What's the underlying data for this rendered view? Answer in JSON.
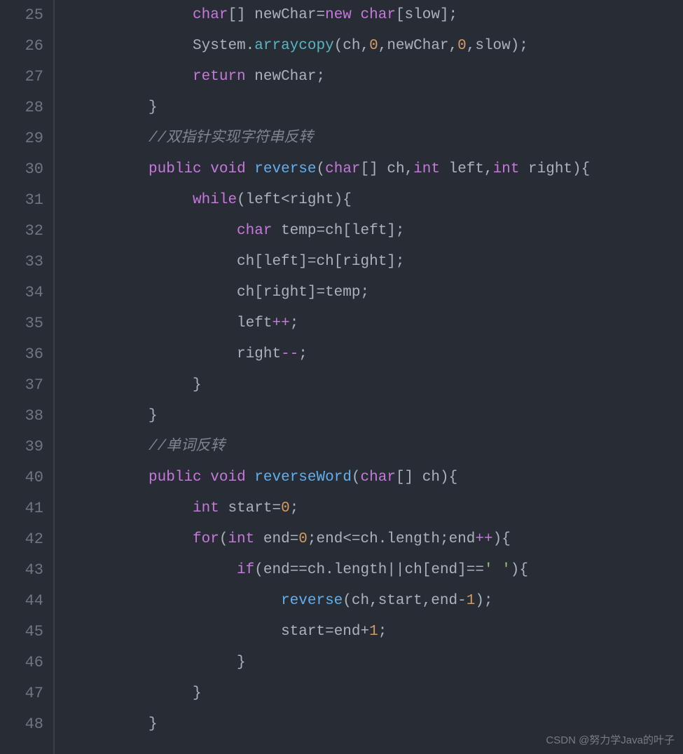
{
  "watermark": "CSDN @努力学Java的叶子",
  "lines": [
    {
      "num": 25,
      "indent": 3,
      "tokens": [
        {
          "t": "char",
          "c": "keyword"
        },
        {
          "t": "[] newChar",
          "c": "default"
        },
        {
          "t": "=",
          "c": "op"
        },
        {
          "t": "new",
          "c": "keyword"
        },
        {
          "t": " ",
          "c": "default"
        },
        {
          "t": "char",
          "c": "keyword"
        },
        {
          "t": "[slow];",
          "c": "default"
        }
      ]
    },
    {
      "num": 26,
      "indent": 3,
      "tokens": [
        {
          "t": "System",
          "c": "default"
        },
        {
          "t": ".",
          "c": "punct"
        },
        {
          "t": "arraycopy",
          "c": "method"
        },
        {
          "t": "(ch,",
          "c": "default"
        },
        {
          "t": "0",
          "c": "num"
        },
        {
          "t": ",newChar,",
          "c": "default"
        },
        {
          "t": "0",
          "c": "num"
        },
        {
          "t": ",slow);",
          "c": "default"
        }
      ]
    },
    {
      "num": 27,
      "indent": 3,
      "tokens": [
        {
          "t": "return",
          "c": "keyword"
        },
        {
          "t": " newChar;",
          "c": "default"
        }
      ]
    },
    {
      "num": 28,
      "indent": 2,
      "tokens": [
        {
          "t": "}",
          "c": "punct"
        }
      ]
    },
    {
      "num": 29,
      "indent": 2,
      "tokens": [
        {
          "t": "//双指针实现字符串反转",
          "c": "comment"
        }
      ]
    },
    {
      "num": 30,
      "indent": 2,
      "tokens": [
        {
          "t": "public",
          "c": "keyword"
        },
        {
          "t": " ",
          "c": "default"
        },
        {
          "t": "void",
          "c": "keyword"
        },
        {
          "t": " ",
          "c": "default"
        },
        {
          "t": "reverse",
          "c": "call"
        },
        {
          "t": "(",
          "c": "punct"
        },
        {
          "t": "char",
          "c": "keyword"
        },
        {
          "t": "[] ch,",
          "c": "default"
        },
        {
          "t": "int",
          "c": "keyword"
        },
        {
          "t": " left,",
          "c": "default"
        },
        {
          "t": "int",
          "c": "keyword"
        },
        {
          "t": " right){",
          "c": "default"
        }
      ]
    },
    {
      "num": 31,
      "indent": 3,
      "tokens": [
        {
          "t": "while",
          "c": "keyword"
        },
        {
          "t": "(left",
          "c": "default"
        },
        {
          "t": "<",
          "c": "op"
        },
        {
          "t": "right){",
          "c": "default"
        }
      ]
    },
    {
      "num": 32,
      "indent": 4,
      "tokens": [
        {
          "t": "char",
          "c": "keyword"
        },
        {
          "t": " temp",
          "c": "default"
        },
        {
          "t": "=",
          "c": "op"
        },
        {
          "t": "ch[left];",
          "c": "default"
        }
      ]
    },
    {
      "num": 33,
      "indent": 4,
      "tokens": [
        {
          "t": "ch[left]",
          "c": "default"
        },
        {
          "t": "=",
          "c": "op"
        },
        {
          "t": "ch[right];",
          "c": "default"
        }
      ]
    },
    {
      "num": 34,
      "indent": 4,
      "tokens": [
        {
          "t": "ch[right]",
          "c": "default"
        },
        {
          "t": "=",
          "c": "op"
        },
        {
          "t": "temp;",
          "c": "default"
        }
      ]
    },
    {
      "num": 35,
      "indent": 4,
      "tokens": [
        {
          "t": "left",
          "c": "default"
        },
        {
          "t": "++",
          "c": "keyword"
        },
        {
          "t": ";",
          "c": "punct"
        }
      ]
    },
    {
      "num": 36,
      "indent": 4,
      "tokens": [
        {
          "t": "right",
          "c": "default"
        },
        {
          "t": "--",
          "c": "keyword"
        },
        {
          "t": ";",
          "c": "punct"
        }
      ]
    },
    {
      "num": 37,
      "indent": 3,
      "tokens": [
        {
          "t": "}",
          "c": "punct"
        }
      ]
    },
    {
      "num": 38,
      "indent": 2,
      "tokens": [
        {
          "t": "}",
          "c": "punct"
        }
      ]
    },
    {
      "num": 39,
      "indent": 2,
      "tokens": [
        {
          "t": "//单词反转",
          "c": "comment"
        }
      ]
    },
    {
      "num": 40,
      "indent": 2,
      "tokens": [
        {
          "t": "public",
          "c": "keyword"
        },
        {
          "t": " ",
          "c": "default"
        },
        {
          "t": "void",
          "c": "keyword"
        },
        {
          "t": " ",
          "c": "default"
        },
        {
          "t": "reverseWord",
          "c": "call"
        },
        {
          "t": "(",
          "c": "punct"
        },
        {
          "t": "char",
          "c": "keyword"
        },
        {
          "t": "[] ch){",
          "c": "default"
        }
      ]
    },
    {
      "num": 41,
      "indent": 3,
      "tokens": [
        {
          "t": "int",
          "c": "keyword"
        },
        {
          "t": " start",
          "c": "default"
        },
        {
          "t": "=",
          "c": "op"
        },
        {
          "t": "0",
          "c": "num"
        },
        {
          "t": ";",
          "c": "punct"
        }
      ]
    },
    {
      "num": 42,
      "indent": 3,
      "tokens": [
        {
          "t": "for",
          "c": "keyword"
        },
        {
          "t": "(",
          "c": "punct"
        },
        {
          "t": "int",
          "c": "keyword"
        },
        {
          "t": " end",
          "c": "default"
        },
        {
          "t": "=",
          "c": "op"
        },
        {
          "t": "0",
          "c": "num"
        },
        {
          "t": ";end",
          "c": "default"
        },
        {
          "t": "<=",
          "c": "op"
        },
        {
          "t": "ch.length;end",
          "c": "default"
        },
        {
          "t": "++",
          "c": "keyword"
        },
        {
          "t": "){",
          "c": "default"
        }
      ]
    },
    {
      "num": 43,
      "indent": 4,
      "tokens": [
        {
          "t": "if",
          "c": "keyword"
        },
        {
          "t": "(end",
          "c": "default"
        },
        {
          "t": "==",
          "c": "op"
        },
        {
          "t": "ch.length",
          "c": "default"
        },
        {
          "t": "||",
          "c": "op"
        },
        {
          "t": "ch[end]",
          "c": "default"
        },
        {
          "t": "==",
          "c": "op"
        },
        {
          "t": "' '",
          "c": "str"
        },
        {
          "t": "){",
          "c": "default"
        }
      ]
    },
    {
      "num": 44,
      "indent": 5,
      "tokens": [
        {
          "t": "reverse",
          "c": "call"
        },
        {
          "t": "(ch,start,end",
          "c": "default"
        },
        {
          "t": "-",
          "c": "op"
        },
        {
          "t": "1",
          "c": "num"
        },
        {
          "t": ");",
          "c": "default"
        }
      ]
    },
    {
      "num": 45,
      "indent": 5,
      "tokens": [
        {
          "t": "start",
          "c": "default"
        },
        {
          "t": "=",
          "c": "op"
        },
        {
          "t": "end",
          "c": "default"
        },
        {
          "t": "+",
          "c": "op"
        },
        {
          "t": "1",
          "c": "num"
        },
        {
          "t": ";",
          "c": "punct"
        }
      ]
    },
    {
      "num": 46,
      "indent": 4,
      "tokens": [
        {
          "t": "}",
          "c": "punct"
        }
      ]
    },
    {
      "num": 47,
      "indent": 3,
      "tokens": [
        {
          "t": "}",
          "c": "punct"
        }
      ]
    },
    {
      "num": 48,
      "indent": 2,
      "tokens": [
        {
          "t": "}",
          "c": "punct"
        }
      ]
    }
  ]
}
